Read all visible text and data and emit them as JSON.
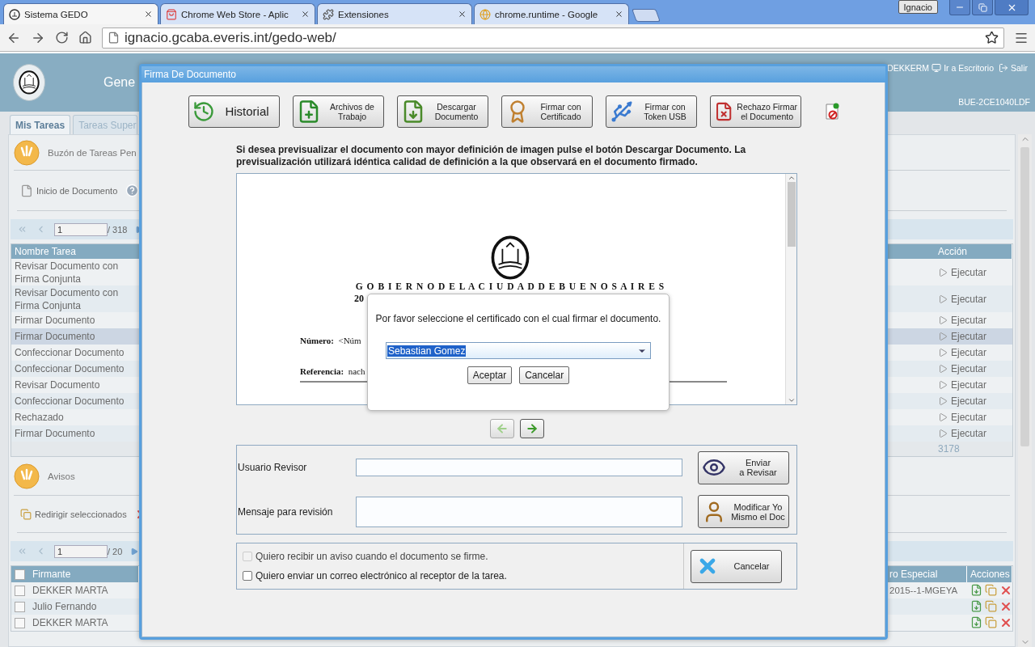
{
  "browser": {
    "tabs": [
      {
        "title": "Sistema GEDO",
        "kind": "site",
        "selected": true
      },
      {
        "title": "Chrome Web Store - Aplic",
        "kind": "store",
        "selected": false
      },
      {
        "title": "Extensiones",
        "kind": "extension",
        "selected": false
      },
      {
        "title": "chrome.runtime - Google",
        "kind": "web",
        "selected": false
      }
    ],
    "user": "Ignacio",
    "url": "ignacio.gcaba.everis.int/gedo-web/"
  },
  "app": {
    "header": {
      "title": "Gene",
      "user": "DEKKERM",
      "desktop": "Ir a Escritorio",
      "logout": "Salir",
      "code": "BUE-2CE1040LDF"
    },
    "tabs": [
      {
        "label": "Mis Tareas",
        "selected": true
      },
      {
        "label": "Tareas Super",
        "selected": false
      }
    ],
    "inbox": {
      "title": "Buzón de Tareas Pen",
      "action": "Inicio de Documento",
      "page": "1",
      "total": "/ 318",
      "columns": [
        "Nombre Tarea",
        "Acción"
      ],
      "rows": [
        {
          "name": "Revisar Documento con Firma Conjunta",
          "action": "Ejecutar",
          "selected": false
        },
        {
          "name": "Revisar Documento con Firma Conjunta",
          "action": "Ejecutar",
          "selected": false
        },
        {
          "name": "Firmar Documento",
          "action": "Ejecutar",
          "selected": false
        },
        {
          "name": "Firmar Documento",
          "action": "Ejecutar",
          "selected": true
        },
        {
          "name": "Confeccionar Documento",
          "action": "Ejecutar",
          "selected": false
        },
        {
          "name": "Confeccionar Documento",
          "action": "Ejecutar",
          "selected": false
        },
        {
          "name": "Revisar Documento",
          "action": "Ejecutar",
          "selected": false
        },
        {
          "name": "Confeccionar Documento",
          "action": "Ejecutar",
          "selected": false
        },
        {
          "name": "Rechazado",
          "action": "Ejecutar",
          "selected": false
        },
        {
          "name": "Firmar Documento",
          "action": "Ejecutar",
          "selected": false
        }
      ],
      "footer_total": "3178"
    },
    "notices": {
      "title": "Avisos",
      "action": "Redirigir seleccionados",
      "page": "1",
      "total": "/ 20",
      "all_checked": false,
      "columns": [
        "Firmante",
        "ro Especial",
        "Acciones"
      ],
      "rows": [
        {
          "signer": "DEKKER MARTA",
          "special": "2015--1-MGEYA",
          "checked": false
        },
        {
          "signer": "Julio Fernando",
          "checked": false
        },
        {
          "signer": "DEKKER MARTA",
          "checked": false
        }
      ]
    }
  },
  "modal": {
    "title": "Firma De Documento",
    "toolbar": [
      {
        "kind": "history",
        "lines": [
          "Historial"
        ]
      },
      {
        "kind": "files",
        "lines": [
          "Archivos de",
          "Trabajo"
        ]
      },
      {
        "kind": "download",
        "lines": [
          "Descargar",
          "Documento"
        ]
      },
      {
        "kind": "certificate",
        "lines": [
          "Firmar con",
          "Certificado"
        ]
      },
      {
        "kind": "token",
        "lines": [
          "Firmar con",
          "Token USB"
        ]
      },
      {
        "kind": "reject",
        "lines": [
          "Rechazo Firmar",
          "el Documento"
        ]
      }
    ],
    "notice": "Si desea previsualizar el documento con mayor definición de imagen pulse el botón Descargar Documento. La previsualización utilizará idéntica calidad de definición a la que observará en el documento firmado.",
    "document": {
      "heading": "G O B I E R N O D E L A C I U D A D D E B U E N O S A I R E S",
      "fragment": "20",
      "fields": [
        {
          "label": "Número:",
          "value": "<Núm"
        },
        {
          "label": "Referencia:",
          "value": "nach"
        }
      ]
    },
    "certificate_dialog": {
      "message": "Por favor seleccione el certificado con el cual firmar el documento.",
      "value": "Sebastian Gomez",
      "buttons": [
        "Aceptar",
        "Cancelar"
      ]
    },
    "pager_buttons": [
      {
        "kind": "prev",
        "disabled": true
      },
      {
        "kind": "next",
        "disabled": false
      }
    ],
    "review": {
      "fields": [
        {
          "label": "Usuario Revisor",
          "kind": "input"
        },
        {
          "label": "Mensaje para revisión",
          "kind": "textarea"
        }
      ],
      "buttons": [
        {
          "kind": "review",
          "lines": [
            "Enviar",
            "a Revisar"
          ]
        },
        {
          "kind": "self",
          "lines": [
            "Modificar Yo",
            "Mismo el Doc"
          ]
        }
      ]
    },
    "options": [
      {
        "label": "Quiero recibir un aviso cuando el documento se firme.",
        "checked": false,
        "disabled": true
      },
      {
        "label": "Quiero enviar un correo electrónico al receptor de la tarea.",
        "checked": false,
        "disabled": false
      }
    ],
    "cancel": "Cancelar"
  }
}
